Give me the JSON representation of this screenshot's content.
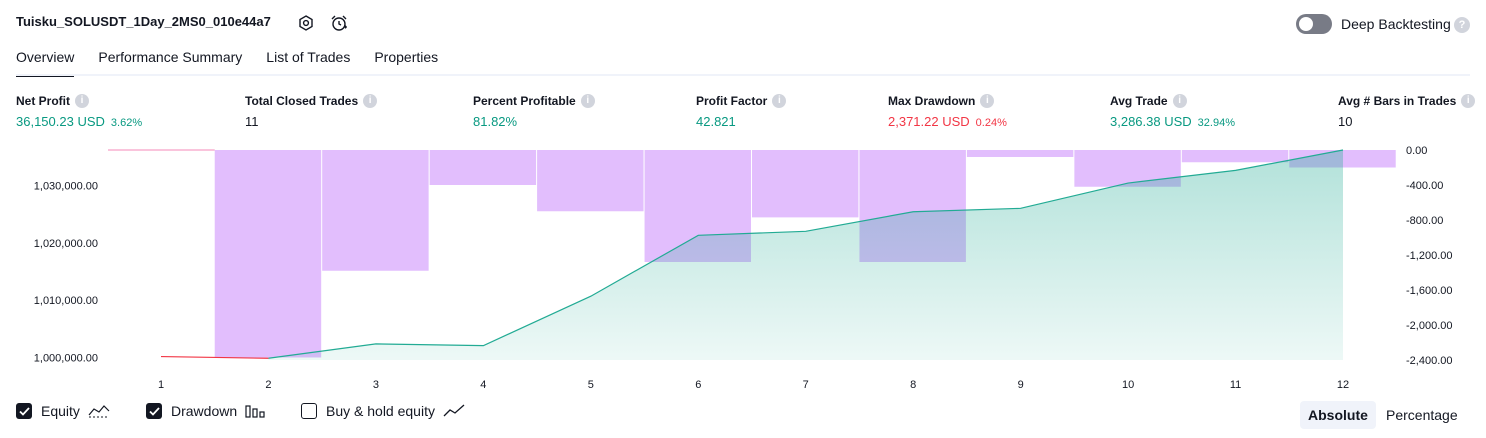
{
  "header": {
    "strategy_title": "Tuisku_SOLUSDT_1Day_2MS0_010e44a7",
    "deep_backtesting_label": "Deep Backtesting",
    "deep_backtesting_on": false,
    "help_glyph": "?"
  },
  "tabs": [
    {
      "label": "Overview",
      "active": true
    },
    {
      "label": "Performance Summary",
      "active": false
    },
    {
      "label": "List of Trades",
      "active": false
    },
    {
      "label": "Properties",
      "active": false
    }
  ],
  "metrics": {
    "info_glyph": "i",
    "net_profit": {
      "label": "Net Profit",
      "value": "36,150.23 USD",
      "pct": "3.62%"
    },
    "total_closed_trades": {
      "label": "Total Closed Trades",
      "value": "11"
    },
    "percent_profitable": {
      "label": "Percent Profitable",
      "value": "81.82%"
    },
    "profit_factor": {
      "label": "Profit Factor",
      "value": "42.821"
    },
    "max_drawdown": {
      "label": "Max Drawdown",
      "value": "2,371.22 USD",
      "pct": "0.24%"
    },
    "avg_trade": {
      "label": "Avg Trade",
      "value": "3,286.38 USD",
      "pct": "32.94%"
    },
    "avg_bars": {
      "label": "Avg # Bars in Trades",
      "value": "10"
    }
  },
  "chart_data": {
    "type": "line",
    "x": [
      1,
      2,
      3,
      4,
      5,
      6,
      7,
      8,
      9,
      10,
      11,
      12
    ],
    "series": [
      {
        "axis": "left",
        "style": "area-line",
        "values": [
          1000200,
          999900,
          1002400,
          1002100,
          1010700,
          1021300,
          1022000,
          1025400,
          1026000,
          1030400,
          1032600,
          1036150
        ]
      },
      {
        "axis": "right",
        "style": "bar",
        "values": [
          0,
          -2371.22,
          -1380,
          -400,
          -700,
          -1280,
          -770,
          -1280,
          -80,
          -420,
          -140,
          -200
        ]
      }
    ],
    "left_ticks": [
      "1,000,000.00",
      "1,010,000.00",
      "1,020,000.00",
      "1,030,000.00"
    ],
    "left_tick_values": [
      1000000,
      1010000,
      1020000,
      1030000
    ],
    "right_ticks": [
      "0.00",
      "-400.00",
      "-800.00",
      "-1,200.00",
      "-1,600.00",
      "-2,000.00",
      "-2,400.00"
    ],
    "right_tick_values": [
      0,
      -400,
      -800,
      -1200,
      -1600,
      -2000,
      -2400
    ],
    "x_ticks": [
      "1",
      "2",
      "3",
      "4",
      "5",
      "6",
      "7",
      "8",
      "9",
      "10",
      "11",
      "12"
    ],
    "left_range": [
      999600,
      1036150
    ],
    "right_range": [
      -2400,
      0
    ],
    "grid": false,
    "colors": {
      "equity_line": "#22ab94",
      "equity_loss_line": "#f23645",
      "equity_fill": "#22ab94",
      "drawdown_bar": "#ce93fc"
    }
  },
  "legend": {
    "equity": {
      "label": "Equity",
      "checked": true,
      "icon": "area-icon"
    },
    "drawdown": {
      "label": "Drawdown",
      "checked": true,
      "icon": "bars-icon"
    },
    "buy_hold": {
      "label": "Buy & hold equity",
      "checked": false,
      "icon": "line-icon"
    }
  },
  "mode_toggle": {
    "absolute_label": "Absolute",
    "percentage_label": "Percentage",
    "active": "Absolute"
  }
}
